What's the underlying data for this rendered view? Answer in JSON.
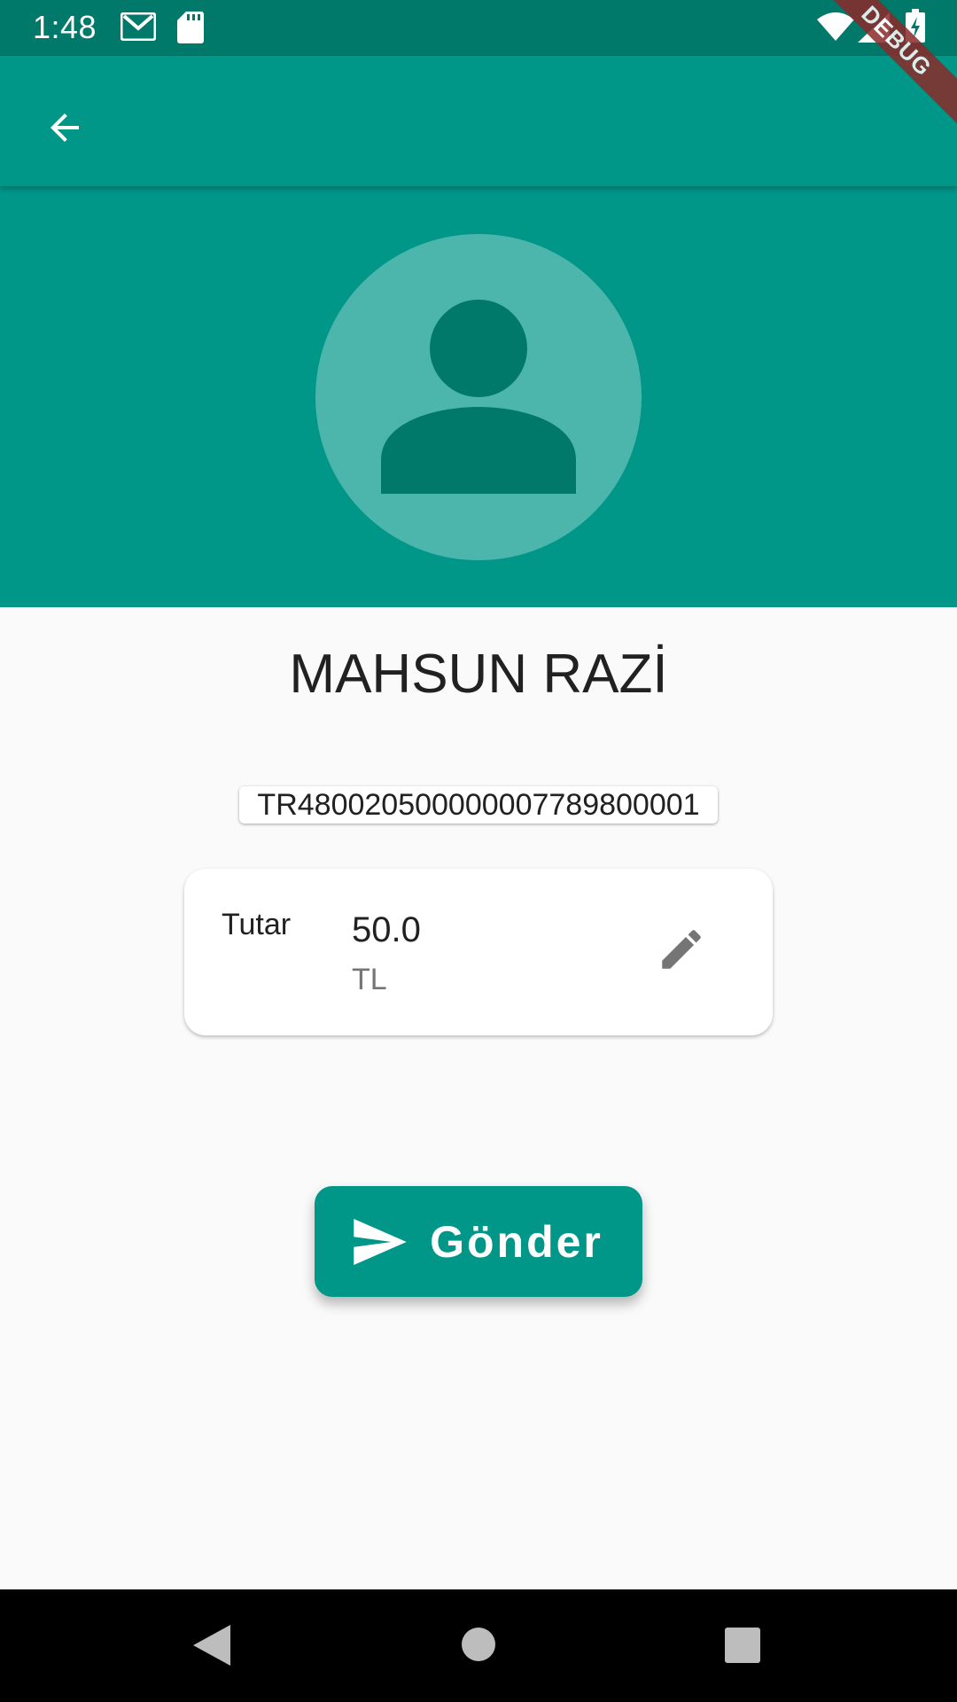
{
  "status_bar": {
    "time": "1:48",
    "icons": [
      "gmail-icon",
      "sd-card-icon",
      "wifi-icon",
      "signal-icon",
      "battery-charging-icon"
    ]
  },
  "debug_banner": {
    "label": "DEBUG"
  },
  "app_bar": {
    "back_icon": "arrow-back-icon"
  },
  "recipient": {
    "avatar_icon": "person-icon",
    "name": "MAHSUN RAZİ",
    "iban": "TR480020500000007789800001"
  },
  "amount_card": {
    "label": "Tutar",
    "value": "50.0",
    "currency": "TL",
    "edit_icon": "pencil-icon"
  },
  "send_button": {
    "label": "Gönder",
    "icon": "send-icon"
  },
  "nav_bar": {
    "icons": [
      "nav-back-icon",
      "nav-home-icon",
      "nav-recents-icon"
    ]
  },
  "colors": {
    "primary": "#009688",
    "primary_dark": "#00796b",
    "avatar_bg": "#4db6ac",
    "avatar_fg": "#00796b",
    "debug_banner": "#8b2a2a"
  }
}
